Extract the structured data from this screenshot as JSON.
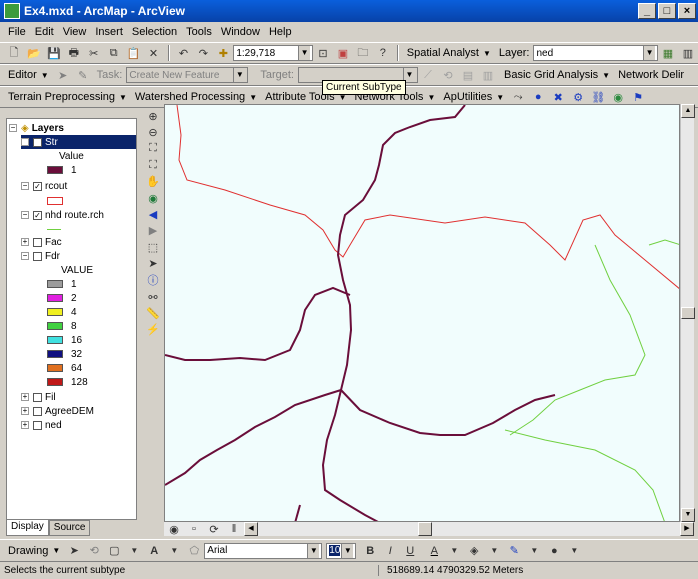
{
  "window": {
    "title": "Ex4.mxd - ArcMap - ArcView",
    "minimize": "_",
    "maximize": "□",
    "close": "×"
  },
  "menu": [
    "File",
    "Edit",
    "View",
    "Insert",
    "Selection",
    "Tools",
    "Window",
    "Help"
  ],
  "standard_toolbar": {
    "scale": "1:29,718",
    "spatial_analyst": "Spatial Analyst",
    "layer_label": "Layer:",
    "layer_value": "ned"
  },
  "editor_toolbar": {
    "editor": "Editor",
    "task_label": "Task:",
    "task_value": "Create New Feature",
    "target_label": "Target:",
    "basic_grid": "Basic Grid Analysis",
    "network_delin": "Network Delir"
  },
  "arc_hydro": {
    "terrain": "Terrain Preprocessing",
    "watershed": "Watershed Processing",
    "attribute": "Attribute Tools",
    "network": "Network Tools",
    "apu": "ApUtilities"
  },
  "tooltip": "Current SubType",
  "toc": {
    "root": "Layers",
    "items": [
      {
        "label": "Str",
        "checked": true
      },
      {
        "label": "Value"
      },
      {
        "label": "1"
      },
      {
        "label": "rcout",
        "checked": true
      },
      {
        "label": "nhd route.rch",
        "checked": true
      },
      {
        "label": "Fac",
        "checked": false
      },
      {
        "label": "Fdr",
        "checked": false
      },
      {
        "label": "VALUE"
      },
      {
        "label": "Fil",
        "checked": false
      },
      {
        "label": "AgreeDEM",
        "checked": false
      },
      {
        "label": "ned",
        "checked": false
      }
    ],
    "fdr_classes": [
      {
        "label": "1",
        "color": "#9c9c9c"
      },
      {
        "label": "2",
        "color": "#e020e0"
      },
      {
        "label": "4",
        "color": "#f0f020"
      },
      {
        "label": "8",
        "color": "#40d040"
      },
      {
        "label": "16",
        "color": "#40e0e0"
      },
      {
        "label": "32",
        "color": "#101080"
      },
      {
        "label": "64",
        "color": "#e07020"
      },
      {
        "label": "128",
        "color": "#c01818"
      }
    ],
    "str_color": "#6a0e3a",
    "rcout_color": "#e03030",
    "nhd_color": "#70d040"
  },
  "tabs": {
    "display": "Display",
    "source": "Source"
  },
  "drawing": {
    "drawing": "Drawing",
    "font": "Arial",
    "size": "10",
    "bold": "B",
    "italic": "I",
    "underline": "U",
    "fontcolor": "A"
  },
  "status": {
    "message": "Selects the current subtype",
    "coords": "518689.14  4790329.52 Meters"
  }
}
